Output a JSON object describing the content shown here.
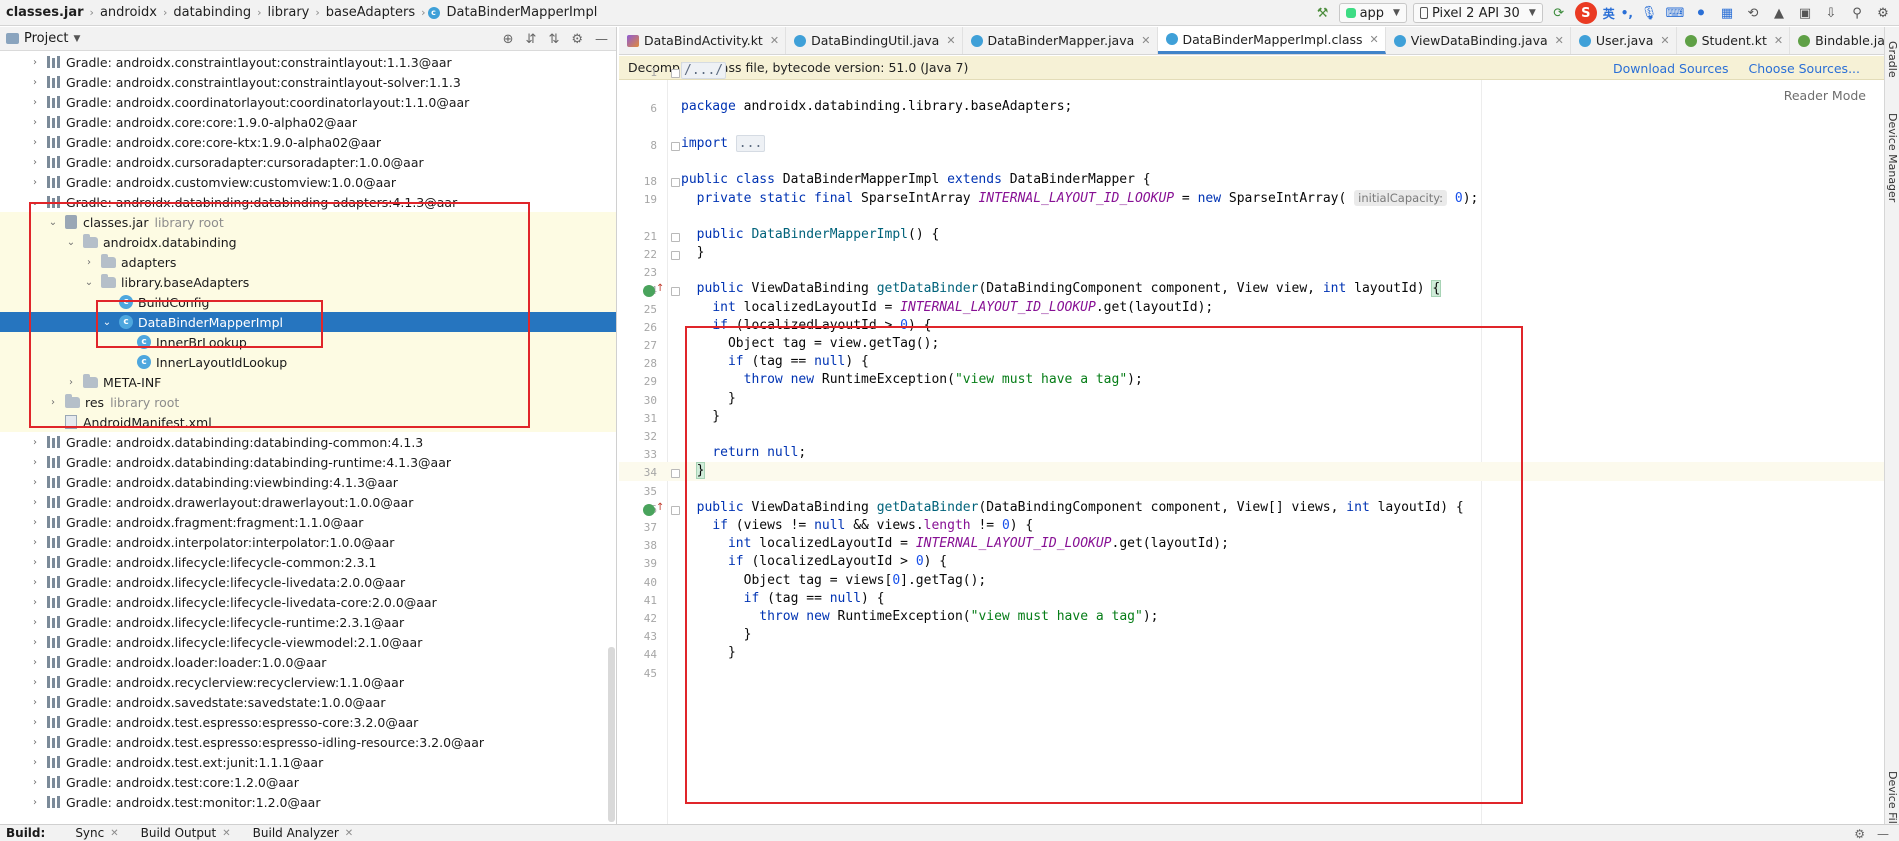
{
  "breadcrumb": [
    "classes.jar",
    "androidx",
    "databinding",
    "library",
    "baseAdapters",
    "DataBinderMapperImpl"
  ],
  "toolbar": {
    "run_config": "app",
    "device": "Pixel 2 API 30",
    "ime_logo": "S",
    "ime_lang": "英",
    "ime_punct": "•,"
  },
  "project_panel": {
    "title": "Project",
    "tree": [
      {
        "depth": 0,
        "arrow": "›",
        "icon": "lib",
        "label": "Gradle: androidx.constraintlayout:constraintlayout:1.1.3@aar"
      },
      {
        "depth": 0,
        "arrow": "›",
        "icon": "lib",
        "label": "Gradle: androidx.constraintlayout:constraintlayout-solver:1.1.3"
      },
      {
        "depth": 0,
        "arrow": "›",
        "icon": "lib",
        "label": "Gradle: androidx.coordinatorlayout:coordinatorlayout:1.1.0@aar"
      },
      {
        "depth": 0,
        "arrow": "›",
        "icon": "lib",
        "label": "Gradle: androidx.core:core:1.9.0-alpha02@aar"
      },
      {
        "depth": 0,
        "arrow": "›",
        "icon": "lib",
        "label": "Gradle: androidx.core:core-ktx:1.9.0-alpha02@aar"
      },
      {
        "depth": 0,
        "arrow": "›",
        "icon": "lib",
        "label": "Gradle: androidx.cursoradapter:cursoradapter:1.0.0@aar"
      },
      {
        "depth": 0,
        "arrow": "›",
        "icon": "lib",
        "label": "Gradle: androidx.customview:customview:1.0.0@aar"
      },
      {
        "depth": 0,
        "arrow": "⌄",
        "icon": "lib",
        "label": "Gradle: androidx.databinding:databinding-adapters:4.1.3@aar"
      },
      {
        "depth": 1,
        "arrow": "⌄",
        "icon": "jar",
        "label": "classes.jar",
        "hint": "library root",
        "hl": true
      },
      {
        "depth": 2,
        "arrow": "⌄",
        "icon": "folder",
        "label": "androidx.databinding",
        "hl": true
      },
      {
        "depth": 3,
        "arrow": "›",
        "icon": "folder",
        "label": "adapters",
        "hl": true
      },
      {
        "depth": 3,
        "arrow": "⌄",
        "icon": "folder",
        "label": "library.baseAdapters",
        "hl": true
      },
      {
        "depth": 4,
        "arrow": "",
        "icon": "class",
        "label": "BuildConfig",
        "hl": true
      },
      {
        "depth": 4,
        "arrow": "⌄",
        "icon": "class",
        "label": "DataBinderMapperImpl",
        "selected": true
      },
      {
        "depth": 5,
        "arrow": "",
        "icon": "class",
        "label": "InnerBrLookup",
        "hl": true
      },
      {
        "depth": 5,
        "arrow": "",
        "icon": "class",
        "label": "InnerLayoutIdLookup",
        "hl": true
      },
      {
        "depth": 2,
        "arrow": "›",
        "icon": "folder",
        "label": "META-INF",
        "hl": true
      },
      {
        "depth": 1,
        "arrow": "›",
        "icon": "folder",
        "label": "res",
        "hint": "library root",
        "hl": true
      },
      {
        "depth": 1,
        "arrow": "",
        "icon": "manifest",
        "label": "AndroidManifest.xml",
        "hl": true
      },
      {
        "depth": 0,
        "arrow": "›",
        "icon": "lib",
        "label": "Gradle: androidx.databinding:databinding-common:4.1.3"
      },
      {
        "depth": 0,
        "arrow": "›",
        "icon": "lib",
        "label": "Gradle: androidx.databinding:databinding-runtime:4.1.3@aar"
      },
      {
        "depth": 0,
        "arrow": "›",
        "icon": "lib",
        "label": "Gradle: androidx.databinding:viewbinding:4.1.3@aar"
      },
      {
        "depth": 0,
        "arrow": "›",
        "icon": "lib",
        "label": "Gradle: androidx.drawerlayout:drawerlayout:1.0.0@aar"
      },
      {
        "depth": 0,
        "arrow": "›",
        "icon": "lib",
        "label": "Gradle: androidx.fragment:fragment:1.1.0@aar"
      },
      {
        "depth": 0,
        "arrow": "›",
        "icon": "lib",
        "label": "Gradle: androidx.interpolator:interpolator:1.0.0@aar"
      },
      {
        "depth": 0,
        "arrow": "›",
        "icon": "lib",
        "label": "Gradle: androidx.lifecycle:lifecycle-common:2.3.1"
      },
      {
        "depth": 0,
        "arrow": "›",
        "icon": "lib",
        "label": "Gradle: androidx.lifecycle:lifecycle-livedata:2.0.0@aar"
      },
      {
        "depth": 0,
        "arrow": "›",
        "icon": "lib",
        "label": "Gradle: androidx.lifecycle:lifecycle-livedata-core:2.0.0@aar"
      },
      {
        "depth": 0,
        "arrow": "›",
        "icon": "lib",
        "label": "Gradle: androidx.lifecycle:lifecycle-runtime:2.3.1@aar"
      },
      {
        "depth": 0,
        "arrow": "›",
        "icon": "lib",
        "label": "Gradle: androidx.lifecycle:lifecycle-viewmodel:2.1.0@aar"
      },
      {
        "depth": 0,
        "arrow": "›",
        "icon": "lib",
        "label": "Gradle: androidx.loader:loader:1.0.0@aar"
      },
      {
        "depth": 0,
        "arrow": "›",
        "icon": "lib",
        "label": "Gradle: androidx.recyclerview:recyclerview:1.1.0@aar"
      },
      {
        "depth": 0,
        "arrow": "›",
        "icon": "lib",
        "label": "Gradle: androidx.savedstate:savedstate:1.0.0@aar"
      },
      {
        "depth": 0,
        "arrow": "›",
        "icon": "lib",
        "label": "Gradle: androidx.test.espresso:espresso-core:3.2.0@aar"
      },
      {
        "depth": 0,
        "arrow": "›",
        "icon": "lib",
        "label": "Gradle: androidx.test.espresso:espresso-idling-resource:3.2.0@aar"
      },
      {
        "depth": 0,
        "arrow": "›",
        "icon": "lib",
        "label": "Gradle: androidx.test.ext:junit:1.1.1@aar"
      },
      {
        "depth": 0,
        "arrow": "›",
        "icon": "lib",
        "label": "Gradle: androidx.test:core:1.2.0@aar"
      },
      {
        "depth": 0,
        "arrow": "›",
        "icon": "lib",
        "label": "Gradle: androidx.test:monitor:1.2.0@aar"
      }
    ]
  },
  "editor": {
    "tabs": [
      {
        "label": "DataBindActivity.kt",
        "icon": "kt"
      },
      {
        "label": "DataBindingUtil.java",
        "icon": "java"
      },
      {
        "label": "DataBinderMapper.java",
        "icon": "java"
      },
      {
        "label": "DataBinderMapperImpl.class",
        "icon": "cls",
        "active": true
      },
      {
        "label": "ViewDataBinding.java",
        "icon": "java"
      },
      {
        "label": "User.java",
        "icon": "java"
      },
      {
        "label": "Student.kt",
        "icon": "ann"
      },
      {
        "label": "Bindable.java",
        "icon": "ann"
      }
    ],
    "banner": "Decompiled .class file, bytecode version: 51.0 (Java 7)",
    "download_sources": "Download Sources",
    "choose_sources": "Choose Sources...",
    "reader_mode": "Reader Mode",
    "lines": [
      {
        "n": "1",
        "html": "<span class=\"fold-stub\">/.../</span>"
      },
      {
        "n": "",
        "html": ""
      },
      {
        "n": "6",
        "html": "<span class=\"kw\">package</span> androidx.databinding.library.baseAdapters;"
      },
      {
        "n": "",
        "html": ""
      },
      {
        "n": "8",
        "html": "<span class=\"kw\">import</span> <span class=\"fold-stub\">...</span>"
      },
      {
        "n": "",
        "html": ""
      },
      {
        "n": "18",
        "html": "<span class=\"kw\">public class</span> DataBinderMapperImpl <span class=\"kw\">extends</span> DataBinderMapper {"
      },
      {
        "n": "19",
        "html": "  <span class=\"kw\">private static final</span> SparseIntArray <span class=\"st\">INTERNAL_LAYOUT_ID_LOOKUP</span> = <span class=\"kw\">new</span> SparseIntArray( <span class=\"hint\">initialCapacity:</span> <span class=\"num\">0</span>);"
      },
      {
        "n": "",
        "html": ""
      },
      {
        "n": "21",
        "html": "  <span class=\"kw\">public</span> <span class=\"fn\">DataBinderMapperImpl</span>() {"
      },
      {
        "n": "22",
        "html": "  }"
      },
      {
        "n": "23",
        "html": ""
      },
      {
        "n": "24",
        "html": "  <span class=\"kw\">public</span> ViewDataBinding <span class=\"fn\">getDataBinder</span>(DataBindingComponent component, View view, <span class=\"kw\">int</span> layoutId) <span class=\"brace-hl\">{</span>"
      },
      {
        "n": "25",
        "html": "    <span class=\"kw\">int</span> localizedLayoutId = <span class=\"st\">INTERNAL_LAYOUT_ID_LOOKUP</span>.get(layoutId);"
      },
      {
        "n": "26",
        "html": "    <span class=\"kw\">if</span> (localizedLayoutId &gt; <span class=\"num\">0</span>) {"
      },
      {
        "n": "27",
        "html": "      Object tag = view.getTag();"
      },
      {
        "n": "28",
        "html": "      <span class=\"kw\">if</span> (tag == <span class=\"kw\">null</span>) {"
      },
      {
        "n": "29",
        "html": "        <span class=\"kw\">throw new</span> RuntimeException(<span class=\"str\">\"view must have a tag\"</span>);"
      },
      {
        "n": "30",
        "html": "      }"
      },
      {
        "n": "31",
        "html": "    }"
      },
      {
        "n": "32",
        "html": ""
      },
      {
        "n": "33",
        "html": "    <span class=\"kw\">return null</span>;"
      },
      {
        "n": "34",
        "html": "  <span class=\"brace-hl\">}</span>"
      },
      {
        "n": "35",
        "html": ""
      },
      {
        "n": "36",
        "html": "  <span class=\"kw\">public</span> ViewDataBinding <span class=\"fn\">getDataBinder</span>(DataBindingComponent component, View[] views, <span class=\"kw\">int</span> layoutId) {"
      },
      {
        "n": "37",
        "html": "    <span class=\"kw\">if</span> (views != <span class=\"kw\">null</span> &amp;&amp; views.<span class=\"st\" style=\"font-style:normal\">length</span> != <span class=\"num\">0</span>) {"
      },
      {
        "n": "38",
        "html": "      <span class=\"kw\">int</span> localizedLayoutId = <span class=\"st\">INTERNAL_LAYOUT_ID_LOOKUP</span>.get(layoutId);"
      },
      {
        "n": "39",
        "html": "      <span class=\"kw\">if</span> (localizedLayoutId &gt; <span class=\"num\">0</span>) {"
      },
      {
        "n": "40",
        "html": "        Object tag = views[<span class=\"num\">0</span>].getTag();"
      },
      {
        "n": "41",
        "html": "        <span class=\"kw\">if</span> (tag == <span class=\"kw\">null</span>) {"
      },
      {
        "n": "42",
        "html": "          <span class=\"kw\">throw new</span> RuntimeException(<span class=\"str\">\"view must have a tag\"</span>);"
      },
      {
        "n": "43",
        "html": "        }"
      },
      {
        "n": "44",
        "html": "      }"
      },
      {
        "n": "45",
        "html": ""
      }
    ]
  },
  "right_strip": {
    "gradle": "Gradle",
    "device_manager": "Device Manager",
    "device_file": "Device File Explorer"
  },
  "bottom": {
    "label": "Build:",
    "tabs": [
      "Sync",
      "Build Output",
      "Build Analyzer"
    ]
  },
  "colors": {
    "selection": "#2675bf",
    "annotation_red": "#e0252a",
    "library_highlight": "#fdfbe3",
    "banner": "#f6f1d6"
  }
}
